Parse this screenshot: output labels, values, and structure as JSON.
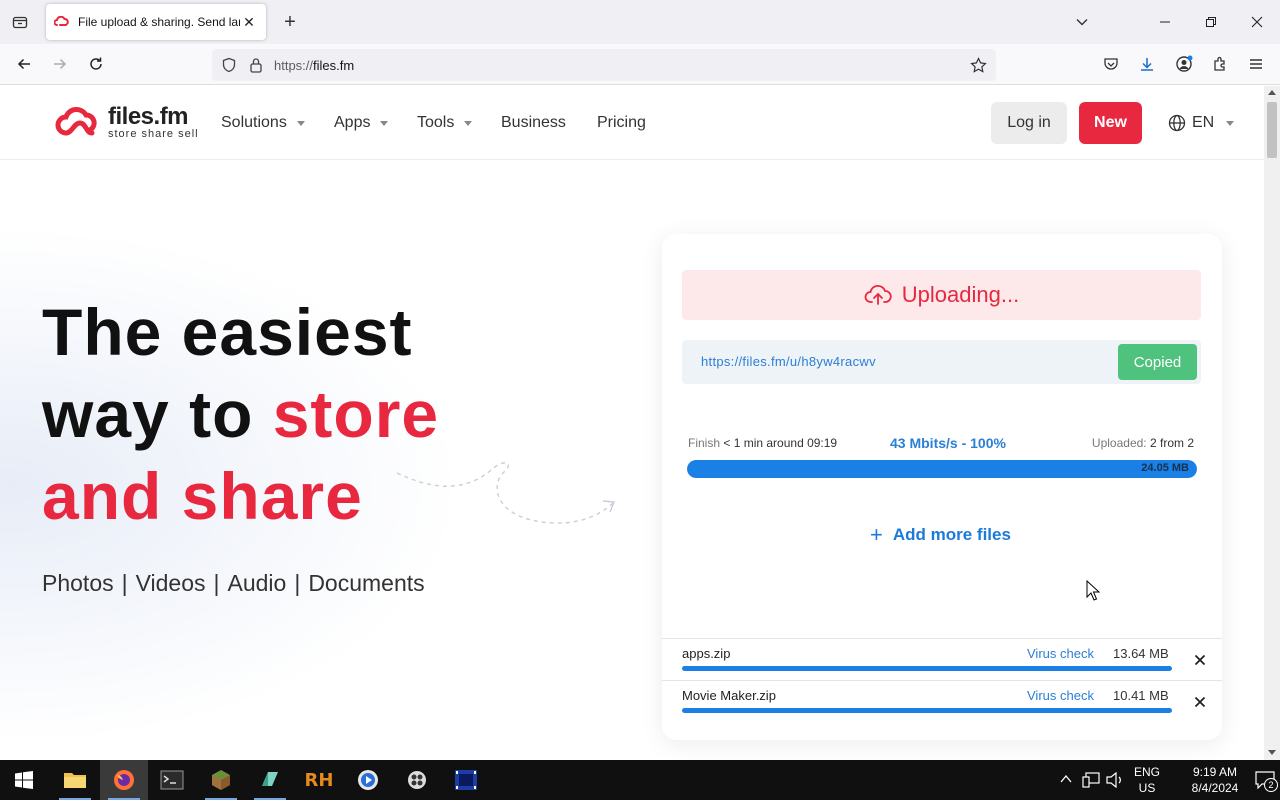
{
  "browser": {
    "tab_title": "File upload & sharing. Send lar",
    "url_scheme": "https://",
    "url_host": "files.fm"
  },
  "site": {
    "logo_name": "files.fm",
    "logo_tagline": "store  share  sell",
    "menu": [
      {
        "label": "Solutions",
        "dropdown": true
      },
      {
        "label": "Apps",
        "dropdown": true
      },
      {
        "label": "Tools",
        "dropdown": true
      },
      {
        "label": "Business",
        "dropdown": false
      },
      {
        "label": "Pricing",
        "dropdown": false
      }
    ],
    "login_label": "Log in",
    "new_label": "New",
    "language": "EN",
    "brand_color": "#e8283f"
  },
  "hero": {
    "line1": "The easiest",
    "line2_plain": "way to ",
    "line2_red": "store",
    "line3_red": "and share",
    "types": [
      "Photos",
      "Videos",
      "Audio",
      "Documents"
    ],
    "separator": "|"
  },
  "upload": {
    "status": "Uploading...",
    "share_link": "https://files.fm/u/h8yw4racwv",
    "copy_label": "Copied",
    "finish_label": "Finish",
    "finish_value": "< 1 min around 09:19",
    "speed": "43 Mbits/s - 100%",
    "uploaded_label": "Uploaded:",
    "uploaded_value": "2 from 2",
    "total_size": "24.05 MB",
    "progress": 1.0,
    "add_more_label": "Add more files",
    "files": [
      {
        "name": "apps.zip",
        "virus_check": "Virus check",
        "size": "13.64 MB",
        "progress": 1.0
      },
      {
        "name": "Movie Maker.zip",
        "virus_check": "Virus check",
        "size": "10.41 MB",
        "progress": 1.0
      }
    ]
  },
  "taskbar": {
    "lang_line1": "ENG",
    "lang_line2": "US",
    "time": "9:19 AM",
    "date": "8/4/2024",
    "notification_count": "2"
  }
}
